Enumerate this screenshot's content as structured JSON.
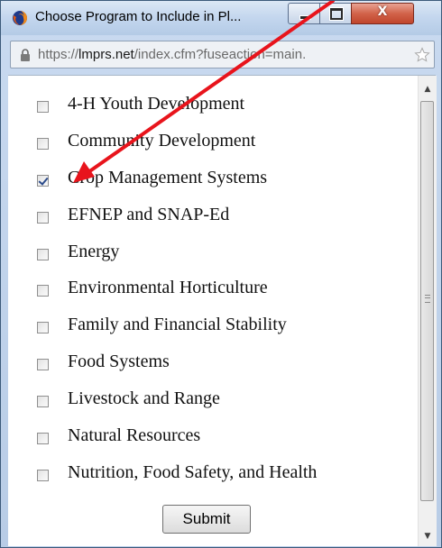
{
  "window": {
    "title": "Choose Program to Include in Pl...",
    "app_icon": "firefox-icon",
    "controls": {
      "minimize_icon": "minimize-icon",
      "maximize_icon": "maximize-icon",
      "close_icon": "close-icon",
      "close_glyph": "X"
    }
  },
  "address_bar": {
    "scheme": "https://",
    "host": "lmprs.net",
    "path": "/index.cfm?fuseaction=main.",
    "lock_icon": "lock-icon",
    "bookmark_icon": "star-icon"
  },
  "options": [
    {
      "label": "4-H Youth Development",
      "checked": false
    },
    {
      "label": "Community Development",
      "checked": false
    },
    {
      "label": "Crop Management Systems",
      "checked": true
    },
    {
      "label": "EFNEP and SNAP-Ed",
      "checked": false
    },
    {
      "label": "Energy",
      "checked": false
    },
    {
      "label": "Environmental Horticulture",
      "checked": false
    },
    {
      "label": "Family and Financial Stability",
      "checked": false
    },
    {
      "label": "Food Systems",
      "checked": false
    },
    {
      "label": "Livestock and Range",
      "checked": false
    },
    {
      "label": "Natural Resources",
      "checked": false
    },
    {
      "label": "Nutrition, Food Safety, and Health",
      "checked": false
    }
  ],
  "submit_label": "Submit",
  "annotation": {
    "type": "arrow",
    "color": "#e8141c"
  },
  "colors": {
    "titlebar": "#c3d6ee",
    "close_button": "#c0452c",
    "annotation_arrow": "#e8141c"
  }
}
